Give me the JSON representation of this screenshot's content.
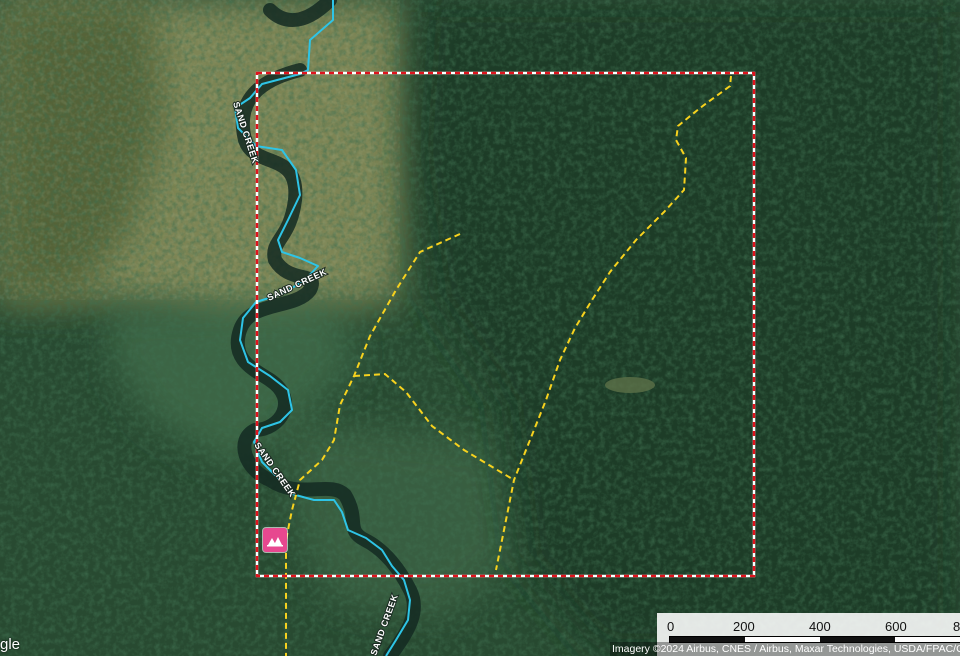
{
  "map": {
    "imagery_attribution": "Imagery ©2024 Airbus, CNES / Airbus, Maxar Technologies, USDA/FPAC/GEO",
    "brand_fragment": "gle",
    "creek_labels": [
      "SAND CREEK",
      "SAND CREEK",
      "SAND CREEK",
      "SAND CREEK"
    ],
    "scale_bar": {
      "ticks": [
        "0",
        "200",
        "400",
        "600",
        "8"
      ]
    },
    "poi": {
      "icon": "campground-icon",
      "color": "#e7488f"
    },
    "colors": {
      "creek": "#2ec4e6",
      "trail": "#f7d21e",
      "boundary_dash_a": "#ff2a2a",
      "boundary_dash_b": "#ffffff"
    }
  }
}
